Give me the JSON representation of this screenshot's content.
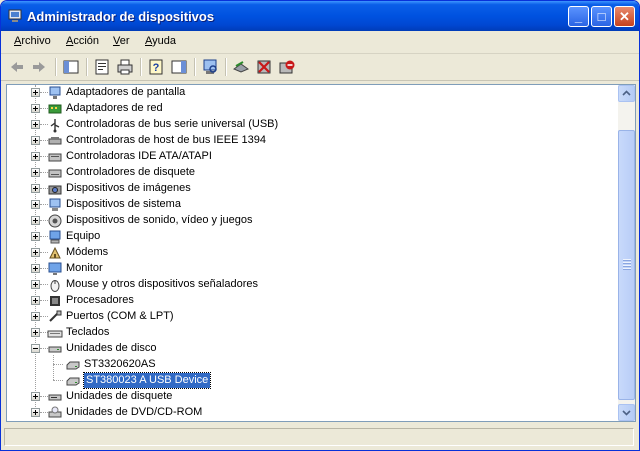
{
  "window": {
    "title": "Administrador de dispositivos",
    "minimize": "_",
    "maximize": "□",
    "close": "✕"
  },
  "menu": [
    {
      "label": "Archivo",
      "mnemonic": "A",
      "rest": "rchivo"
    },
    {
      "label": "Acción",
      "mnemonic": "A",
      "rest": "cción"
    },
    {
      "label": "Ver",
      "mnemonic": "V",
      "rest": "er"
    },
    {
      "label": "Ayuda",
      "mnemonic": "A",
      "rest": "yuda"
    }
  ],
  "toolbar": [
    "back-arrow-icon",
    "forward-arrow-icon",
    "show-hide-console-tree-icon",
    "properties-icon",
    "print-icon",
    "help-icon",
    "show-hide-action-pane-icon",
    "scan-hardware-icon",
    "update-driver-icon",
    "uninstall-icon",
    "disable-device-icon"
  ],
  "tree": [
    {
      "label": "Adaptadores de pantalla",
      "icon": "display-adapter-icon",
      "expanded": false
    },
    {
      "label": "Adaptadores de red",
      "icon": "network-adapter-icon",
      "expanded": false
    },
    {
      "label": "Controladoras de bus serie universal (USB)",
      "icon": "usb-icon",
      "expanded": false
    },
    {
      "label": "Controladoras de host de bus IEEE 1394",
      "icon": "ieee1394-icon",
      "expanded": false
    },
    {
      "label": "Controladoras IDE ATA/ATAPI",
      "icon": "ide-controller-icon",
      "expanded": false
    },
    {
      "label": "Controladores de disquete",
      "icon": "floppy-controller-icon",
      "expanded": false
    },
    {
      "label": "Dispositivos de imágenes",
      "icon": "imaging-device-icon",
      "expanded": false
    },
    {
      "label": "Dispositivos de sistema",
      "icon": "system-device-icon",
      "expanded": false
    },
    {
      "label": "Dispositivos de sonido, vídeo y juegos",
      "icon": "sound-device-icon",
      "expanded": false
    },
    {
      "label": "Equipo",
      "icon": "computer-icon",
      "expanded": false
    },
    {
      "label": "Módems",
      "icon": "modem-icon",
      "expanded": false
    },
    {
      "label": "Monitor",
      "icon": "monitor-icon",
      "expanded": false
    },
    {
      "label": "Mouse y otros dispositivos señaladores",
      "icon": "mouse-icon",
      "expanded": false
    },
    {
      "label": "Procesadores",
      "icon": "processor-icon",
      "expanded": false
    },
    {
      "label": "Puertos (COM & LPT)",
      "icon": "port-icon",
      "expanded": false
    },
    {
      "label": "Teclados",
      "icon": "keyboard-icon",
      "expanded": false
    },
    {
      "label": "Unidades de disco",
      "icon": "disk-drive-icon",
      "expanded": true,
      "children": [
        {
          "label": "ST3320620AS",
          "icon": "hard-disk-icon"
        },
        {
          "label": "ST380023 A USB Device",
          "icon": "hard-disk-icon",
          "selected": true
        }
      ]
    },
    {
      "label": "Unidades de disquete",
      "icon": "floppy-drive-icon",
      "expanded": false
    },
    {
      "label": "Unidades de DVD/CD-ROM",
      "icon": "dvd-drive-icon",
      "expanded": false
    }
  ],
  "status": ""
}
